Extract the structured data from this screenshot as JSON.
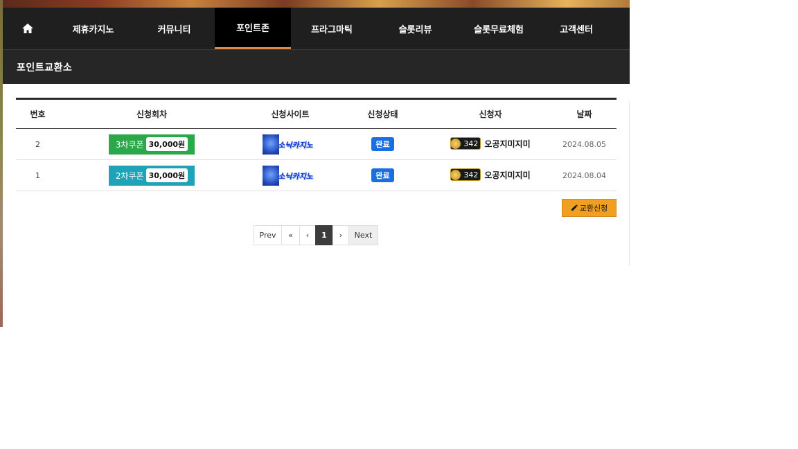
{
  "nav": {
    "items": [
      "제휴카지노",
      "커뮤니티",
      "포인트존",
      "프라그마틱",
      "슬롯리뷰",
      "슬롯무료체험",
      "고객센터"
    ],
    "active": "포인트존"
  },
  "subhead": {
    "title": "포인트교환소"
  },
  "table": {
    "headers": [
      "번호",
      "신청회차",
      "신청사이트",
      "신청상태",
      "신청자",
      "날짜"
    ],
    "rows": [
      {
        "no": "2",
        "coupon": "3차쿠폰",
        "amount": "30,000원",
        "coupon_color": "#2aa84a",
        "site": "소닉카지노",
        "status": "완료",
        "level": "342",
        "user": "오공지미지미",
        "date": "2024.08.05"
      },
      {
        "no": "1",
        "coupon": "2차쿠폰",
        "amount": "30,000원",
        "coupon_color": "#1fa3b8",
        "site": "소닉카지노",
        "status": "완료",
        "level": "342",
        "user": "오공지미지미",
        "date": "2024.08.04"
      }
    ]
  },
  "actions": {
    "exchange_label": "교환신청"
  },
  "pagination": {
    "prev": "Prev",
    "first": "«",
    "lt": "‹",
    "current": "1",
    "gt": "›",
    "next": "Next"
  },
  "colors": {
    "nav_bg": "#1f1f1f",
    "active_underline": "#e0894a",
    "status_blue": "#1a6fe0",
    "exchange_orange": "#f0a020"
  }
}
